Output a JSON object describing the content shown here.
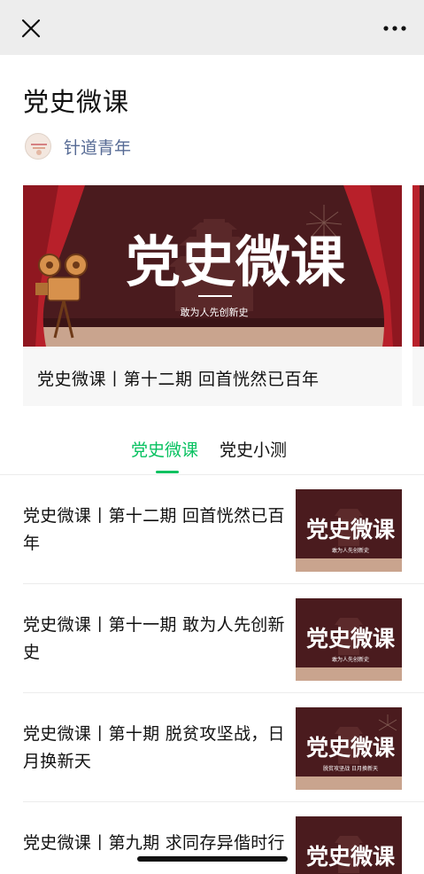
{
  "topbar": {
    "close_icon": "close-icon",
    "more_icon": "more-dots-icon"
  },
  "album": {
    "title": "党史微课"
  },
  "author": {
    "name": "针道青年",
    "avatar_icon": "account-avatar-icon"
  },
  "cover": {
    "art_title": "党史微课",
    "art_subtitle": "敢为人先创新史",
    "caption": "党史微课丨第十二期 回首恍然已百年"
  },
  "tabs": [
    {
      "label": "党史微课",
      "active": true
    },
    {
      "label": "党史小测",
      "active": false
    }
  ],
  "list": [
    {
      "title": "党史微课丨第十二期 回首恍然已百年",
      "thumb_title": "党史微课",
      "thumb_subtitle": "敢为人先创新史"
    },
    {
      "title": "党史微课丨第十一期 敢为人先创新史",
      "thumb_title": "党史微课",
      "thumb_subtitle": "敢为人先创新史"
    },
    {
      "title": "党史微课丨第十期 脱贫攻坚战，日月换新天",
      "thumb_title": "党史微课",
      "thumb_subtitle": "脱贫攻坚战 日月换新天"
    },
    {
      "title": "党史微课丨第九期 求同存异偕时行",
      "thumb_title": "党史微课",
      "thumb_subtitle": ""
    }
  ],
  "colors": {
    "accent": "#07c160",
    "link": "#576b95",
    "art_bg": "#4a1b1e",
    "curtain": "#b8202a",
    "stage": "#c9a48e"
  }
}
